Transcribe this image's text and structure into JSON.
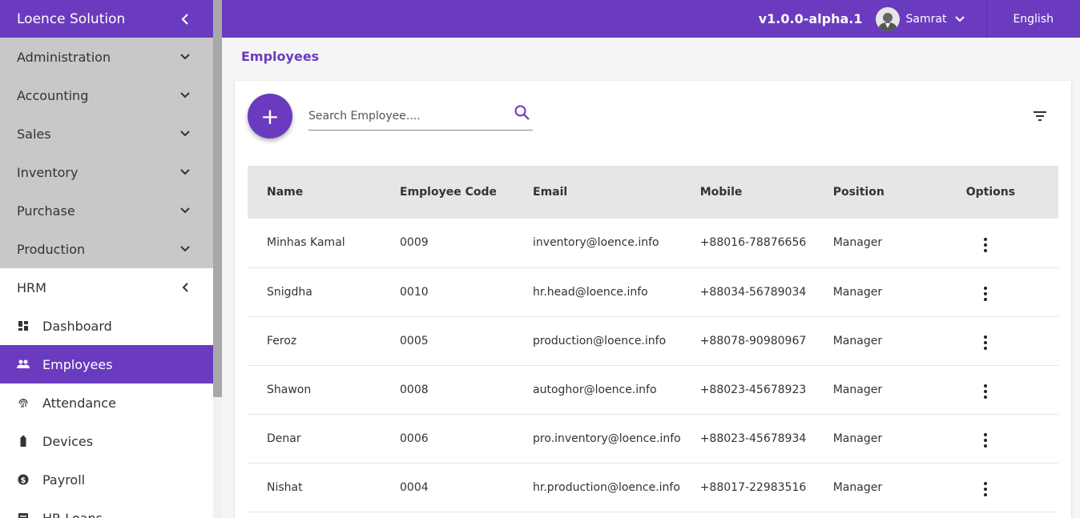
{
  "sidebar": {
    "title": "Loence Solution",
    "groups": [
      {
        "label": "Administration"
      },
      {
        "label": "Accounting"
      },
      {
        "label": "Sales"
      },
      {
        "label": "Inventory"
      },
      {
        "label": "Purchase"
      },
      {
        "label": "Production"
      }
    ],
    "hrm": {
      "label": "HRM",
      "items": [
        {
          "label": "Dashboard",
          "icon": "dashboard-icon"
        },
        {
          "label": "Employees",
          "icon": "people-icon"
        },
        {
          "label": "Attendance",
          "icon": "fingerprint-icon"
        },
        {
          "label": "Devices",
          "icon": "battery-icon"
        },
        {
          "label": "Payroll",
          "icon": "dollar-icon"
        },
        {
          "label": "HR Loans",
          "icon": "list-icon"
        }
      ]
    }
  },
  "topbar": {
    "version": "v1.0.0-alpha.1",
    "username": "Samrat",
    "language": "English"
  },
  "page": {
    "title": "Employees",
    "search_placeholder": "Search Employee....",
    "add_label": "+"
  },
  "table": {
    "headers": [
      "Name",
      "Employee Code",
      "Email",
      "Mobile",
      "Position",
      "Options"
    ],
    "rows": [
      {
        "name": "Minhas Kamal",
        "code": "0009",
        "email": "inventory@loence.info",
        "mobile": "+88016-78876656",
        "position": "Manager"
      },
      {
        "name": "Snigdha",
        "code": "0010",
        "email": "hr.head@loence.info",
        "mobile": "+88034-56789034",
        "position": "Manager"
      },
      {
        "name": "Feroz",
        "code": "0005",
        "email": "production@loence.info",
        "mobile": "+88078-90980967",
        "position": "Manager"
      },
      {
        "name": "Shawon",
        "code": "0008",
        "email": "autoghor@loence.info",
        "mobile": "+88023-45678923",
        "position": "Manager"
      },
      {
        "name": "Denar",
        "code": "0006",
        "email": "pro.inventory@loence.info",
        "mobile": "+88023-45678934",
        "position": "Manager"
      },
      {
        "name": "Nishat",
        "code": "0004",
        "email": "hr.production@loence.info",
        "mobile": "+88017-22983516",
        "position": "Manager"
      }
    ]
  },
  "colors": {
    "primary": "#6a3bbf",
    "sidebar_group_bg": "#c8c8c8",
    "table_header_bg": "#e6e6e6"
  }
}
